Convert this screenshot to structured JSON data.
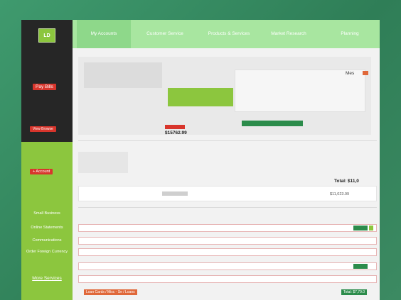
{
  "nav": {
    "logo": "LD",
    "tabs": [
      "My Accounts",
      "Customer Service",
      "Products & Services",
      "Market Research",
      "Planning"
    ]
  },
  "sidebar": {
    "pay_bills": "Pay Bills",
    "view_browse": "View Browse",
    "add_account": "+ Account",
    "links": [
      "Small Business",
      "Online Statements",
      "Communications",
      "Order Foreign Currency"
    ],
    "more_services": "More Services"
  },
  "summary": {
    "balance": "$15762.99",
    "total_label": "Total: $11,0",
    "total_value": "$11,023.99",
    "menu_label": "Mes"
  },
  "rows": {
    "bottom_label": "Loan Cards / Misc - Se / Loans",
    "bottom_value": "Total: $7,79.0"
  },
  "colors": {
    "accent_green": "#8cc63e",
    "nav_green": "#a8e6a0",
    "sidebar_dark": "#262626",
    "alert_red": "#d8352c"
  }
}
